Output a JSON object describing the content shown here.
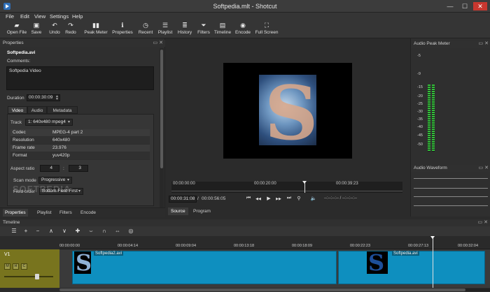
{
  "window": {
    "title": "Softpedia.mlt - Shotcut",
    "min_glyph": "—",
    "max_glyph": "☐",
    "close_glyph": "✕"
  },
  "menu": [
    "File",
    "Edit",
    "View",
    "Settings",
    "Help"
  ],
  "toolbar": [
    {
      "label": "Open File",
      "icon": "folder-open-icon",
      "glyph": "▰"
    },
    {
      "label": "Save",
      "icon": "save-icon",
      "glyph": "▣"
    },
    {
      "label": "Undo",
      "icon": "undo-icon",
      "glyph": "↶"
    },
    {
      "label": "Redo",
      "icon": "redo-icon",
      "glyph": "↷"
    },
    {
      "label": "Peak Meter",
      "icon": "peak-meter-icon",
      "glyph": "▮▮"
    },
    {
      "label": "Properties",
      "icon": "properties-icon",
      "glyph": "ℹ"
    },
    {
      "label": "Recent",
      "icon": "recent-icon",
      "glyph": "◷"
    },
    {
      "label": "Playlist",
      "icon": "playlist-icon",
      "glyph": "☰"
    },
    {
      "label": "History",
      "icon": "history-icon",
      "glyph": "≣"
    },
    {
      "label": "Filters",
      "icon": "filters-icon",
      "glyph": "⏷"
    },
    {
      "label": "Timeline",
      "icon": "timeline-icon",
      "glyph": "▤"
    },
    {
      "label": "Encode",
      "icon": "encode-icon",
      "glyph": "◉"
    },
    {
      "label": "Full Screen",
      "icon": "full-screen-icon",
      "glyph": "⛶"
    }
  ],
  "properties": {
    "header": "Properties",
    "filename": "Softpedia.avi",
    "comments_label": "Comments:",
    "comments_value": "Softpedia Video",
    "duration_label": "Duration",
    "duration_value": "00:00:30:09",
    "tabs": [
      "Video",
      "Audio",
      "Metadata"
    ],
    "track_label": "Track",
    "track_value": "1: 640x480 mpeg4",
    "media": [
      {
        "key": "Codec",
        "value": "MPEG-4 part 2"
      },
      {
        "key": "Resolution",
        "value": "640x480"
      },
      {
        "key": "Frame rate",
        "value": "23.976"
      },
      {
        "key": "Format",
        "value": "yuv420p"
      }
    ],
    "aspect_label": "Aspect ratio",
    "aspect_w": "4",
    "aspect_sep": ":",
    "aspect_h": "3",
    "scan_label": "Scan mode",
    "scan_value": "Progressive",
    "field_label": "Field order",
    "field_value": "Bottom Field First",
    "watermark": "SOFTPEDIA"
  },
  "dock_tabs": [
    "Properties",
    "Playlist",
    "Filters",
    "Encode"
  ],
  "player": {
    "timecodes": [
      "00:00:00:00",
      "00:00:20:00",
      "00:00:39:23"
    ],
    "current_pos": "00:00:31:08",
    "total": "00:00:56:05",
    "inout": "--:--:--:-- /   --:--:--:--",
    "source_tab": "Source",
    "program_tab": "Program",
    "glyphs": {
      "skip_start": "⏮",
      "rewind": "◀◀",
      "play": "▶",
      "forward": "▶▶",
      "skip_end": "⏭",
      "zoom": "⚲",
      "volume": "🔈",
      "spin_up": "▲",
      "spin_down": "▼",
      "dropdown": "▾"
    }
  },
  "audio_meter": {
    "header": "Audio Peak Meter",
    "scale": [
      "-5",
      "-9",
      "-15",
      "-20",
      "-25",
      "-30",
      "-35",
      "-40",
      "-45",
      "-50"
    ]
  },
  "audio_waveform": {
    "header": "Audio Waveform"
  },
  "panel_glyphs": {
    "float": "▭",
    "close": "✕"
  },
  "timeline": {
    "header": "Timeline",
    "tools": [
      "☰",
      "+",
      "−",
      "∧",
      "∨",
      "✚",
      "⌣",
      "∩",
      "⇔",
      "◎"
    ],
    "ruler": [
      "00:00:00:00",
      "00:00:04:14",
      "00:00:09:04",
      "00:00:13:18",
      "00:00:18:09",
      "00:00:22:23",
      "00:00:27:13",
      "00:00:32:04"
    ],
    "track_name": "V1",
    "track_buttons": [
      "M",
      "H",
      "C"
    ],
    "clips": [
      {
        "name": "Softpedia2.avi"
      },
      {
        "name": "Softpedia.avi"
      }
    ]
  },
  "colors": {
    "accent": "#0e8fbf",
    "meter_green": "#33c13a",
    "track_head": "#78741e",
    "close_red": "#c7372f"
  }
}
